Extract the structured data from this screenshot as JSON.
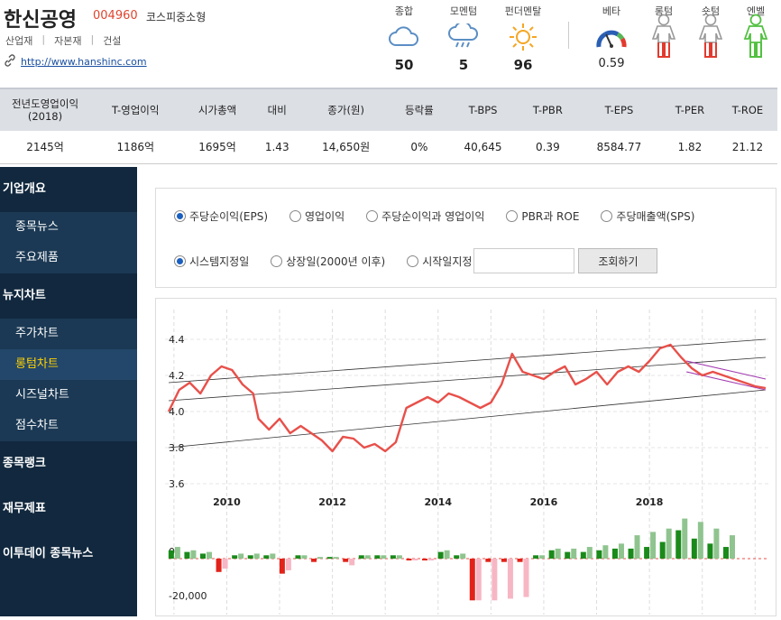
{
  "company": {
    "name": "한신공영",
    "code": "004960",
    "market": "코스피중소형",
    "tags": [
      "산업재",
      "자본재",
      "건설"
    ],
    "url": "http://www.hanshinc.com"
  },
  "metrics": [
    {
      "label": "종합",
      "value": "50",
      "icon": "cloud-icon"
    },
    {
      "label": "모멘텀",
      "value": "5",
      "icon": "rain-cloud-icon"
    },
    {
      "label": "펀더멘탈",
      "value": "96",
      "icon": "sun-icon"
    }
  ],
  "beta": {
    "label": "베타",
    "value": "0.59"
  },
  "figures": [
    {
      "label": "롱텀",
      "colors": "red-legs"
    },
    {
      "label": "숏텀",
      "colors": "red-legs"
    },
    {
      "label": "엔벨",
      "colors": "green"
    }
  ],
  "summary": {
    "headers": [
      "전년도영업이익\n(2018)",
      "T-영업이익",
      "시가총액",
      "대비",
      "종가(원)",
      "등락률",
      "T-BPS",
      "T-PBR",
      "T-EPS",
      "T-PER",
      "T-ROE"
    ],
    "values": [
      "2145억",
      "1186억",
      "1695억",
      "1.43",
      "14,650원",
      "0%",
      "40,645",
      "0.39",
      "8584.77",
      "1.82",
      "21.12"
    ]
  },
  "sidebar": {
    "sections": [
      {
        "label": "기업개요",
        "items": [
          "종목뉴스",
          "주요제품"
        ]
      },
      {
        "label": "뉴지차트",
        "items": [
          "주가차트",
          "롱텀차트",
          "시즈널차트",
          "점수차트"
        ]
      },
      {
        "label": "종목랭크",
        "items": []
      },
      {
        "label": "재무제표",
        "items": []
      },
      {
        "label": "이투데이 종목뉴스",
        "items": []
      }
    ],
    "active_item": "롱텀차트"
  },
  "options": {
    "metric_radios": [
      "주당순이익(EPS)",
      "영업이익",
      "주당순이익과 영업이익",
      "PBR과 ROE",
      "주당매출액(SPS)"
    ],
    "metric_selected": 0,
    "date_radios": [
      "시스템지정일",
      "상장일(2000년 이후)",
      "시작일지정"
    ],
    "date_selected": 0,
    "date_value": "",
    "search_button": "조회하기"
  },
  "chart_data": {
    "type": "line",
    "x_labels": [
      "2010",
      "2012",
      "2014",
      "2016",
      "2018"
    ],
    "y_labels": [
      "4.4",
      "4.2",
      "4.0",
      "3.8",
      "3.6"
    ],
    "ylim": [
      3.6,
      4.4
    ],
    "price_line_color": "#e8504a",
    "price_series": [
      [
        2008.9,
        4.0
      ],
      [
        2009.1,
        4.12
      ],
      [
        2009.3,
        4.16
      ],
      [
        2009.5,
        4.1
      ],
      [
        2009.7,
        4.2
      ],
      [
        2009.9,
        4.25
      ],
      [
        2010.1,
        4.23
      ],
      [
        2010.3,
        4.15
      ],
      [
        2010.5,
        4.1
      ],
      [
        2010.6,
        3.96
      ],
      [
        2010.8,
        3.9
      ],
      [
        2011.0,
        3.96
      ],
      [
        2011.2,
        3.88
      ],
      [
        2011.4,
        3.92
      ],
      [
        2011.6,
        3.88
      ],
      [
        2011.8,
        3.84
      ],
      [
        2012.0,
        3.78
      ],
      [
        2012.2,
        3.86
      ],
      [
        2012.4,
        3.85
      ],
      [
        2012.6,
        3.8
      ],
      [
        2012.8,
        3.82
      ],
      [
        2013.0,
        3.78
      ],
      [
        2013.2,
        3.83
      ],
      [
        2013.4,
        4.02
      ],
      [
        2013.6,
        4.05
      ],
      [
        2013.8,
        4.08
      ],
      [
        2014.0,
        4.05
      ],
      [
        2014.2,
        4.1
      ],
      [
        2014.4,
        4.08
      ],
      [
        2014.6,
        4.05
      ],
      [
        2014.8,
        4.02
      ],
      [
        2015.0,
        4.05
      ],
      [
        2015.2,
        4.15
      ],
      [
        2015.4,
        4.32
      ],
      [
        2015.6,
        4.22
      ],
      [
        2015.8,
        4.2
      ],
      [
        2016.0,
        4.18
      ],
      [
        2016.2,
        4.22
      ],
      [
        2016.4,
        4.25
      ],
      [
        2016.6,
        4.15
      ],
      [
        2016.8,
        4.18
      ],
      [
        2017.0,
        4.22
      ],
      [
        2017.2,
        4.15
      ],
      [
        2017.4,
        4.22
      ],
      [
        2017.6,
        4.25
      ],
      [
        2017.8,
        4.22
      ],
      [
        2018.0,
        4.28
      ],
      [
        2018.2,
        4.35
      ],
      [
        2018.4,
        4.37
      ],
      [
        2018.6,
        4.3
      ],
      [
        2018.8,
        4.24
      ],
      [
        2019.0,
        4.2
      ],
      [
        2019.2,
        4.22
      ],
      [
        2019.4,
        4.2
      ],
      [
        2019.6,
        4.18
      ],
      [
        2019.8,
        4.16
      ],
      [
        2020.0,
        4.14
      ],
      [
        2020.2,
        4.13
      ]
    ],
    "trend_lines": {
      "upper": [
        [
          2008.9,
          4.16
        ],
        [
          2020.2,
          4.4
        ]
      ],
      "mid": [
        [
          2008.9,
          4.06
        ],
        [
          2020.2,
          4.3
        ]
      ],
      "lower": [
        [
          2008.9,
          3.8
        ],
        [
          2020.2,
          4.12
        ]
      ]
    },
    "bar_series": {
      "label": "EPS",
      "ylabels": [
        "0",
        "-20,000"
      ],
      "items": [
        [
          2009.0,
          0.35,
          0.25
        ],
        [
          2009.3,
          0.25,
          0.2
        ],
        [
          2009.6,
          0.2,
          0.15
        ],
        [
          2009.9,
          -0.3,
          -0.4
        ],
        [
          2010.2,
          0.15,
          0.1
        ],
        [
          2010.5,
          0.15,
          0.1
        ],
        [
          2010.8,
          0.15,
          0.1
        ],
        [
          2011.1,
          -0.35,
          -0.45
        ],
        [
          2011.4,
          0.1,
          0.1
        ],
        [
          2011.7,
          0.05,
          -0.1
        ],
        [
          2012.0,
          0.05,
          0.05
        ],
        [
          2012.3,
          -0.2,
          -0.1
        ],
        [
          2012.6,
          0.1,
          0.1
        ],
        [
          2012.9,
          0.1,
          0.1
        ],
        [
          2013.2,
          0.1,
          0.1
        ],
        [
          2013.5,
          -0.05,
          -0.05
        ],
        [
          2013.8,
          -0.05,
          -0.05
        ],
        [
          2014.1,
          0.25,
          0.2
        ],
        [
          2014.4,
          0.15,
          0.1
        ],
        [
          2014.7,
          -1.25,
          -1.25
        ],
        [
          2015.0,
          -1.25,
          -0.1
        ],
        [
          2015.3,
          -1.2,
          -0.1
        ],
        [
          2015.6,
          -1.15,
          -0.1
        ],
        [
          2015.9,
          0.1,
          0.1
        ],
        [
          2016.2,
          0.3,
          0.25
        ],
        [
          2016.5,
          0.3,
          0.2
        ],
        [
          2016.8,
          0.35,
          0.2
        ],
        [
          2017.1,
          0.4,
          0.25
        ],
        [
          2017.4,
          0.45,
          0.3
        ],
        [
          2017.7,
          0.7,
          0.3
        ],
        [
          2018.0,
          0.8,
          0.35
        ],
        [
          2018.3,
          0.9,
          0.5
        ],
        [
          2018.6,
          1.2,
          0.85
        ],
        [
          2018.9,
          1.1,
          0.6
        ],
        [
          2019.2,
          0.9,
          0.45
        ],
        [
          2019.5,
          0.7,
          0.35
        ]
      ]
    }
  }
}
